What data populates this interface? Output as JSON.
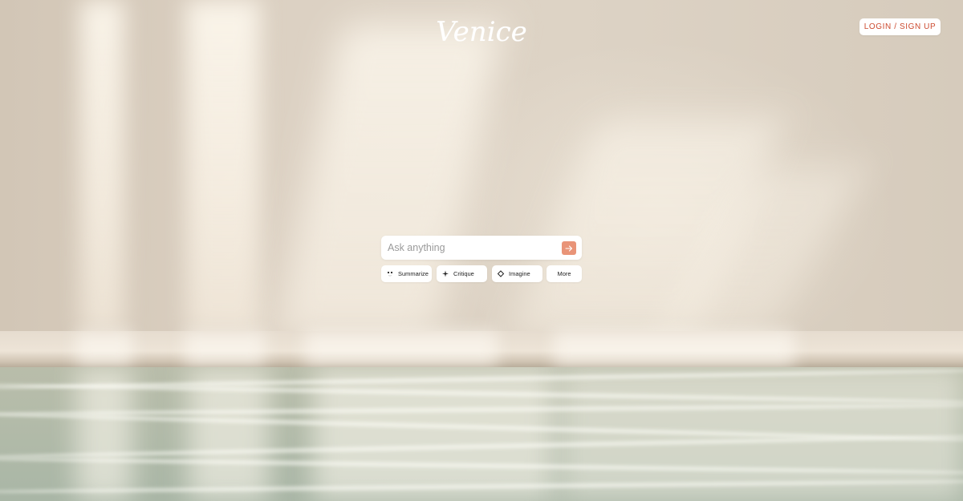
{
  "header": {
    "logo_text": "Venice",
    "login_label": "LOGIN / SIGN UP"
  },
  "search": {
    "placeholder": "Ask anything",
    "send_icon": "arrow-right-icon"
  },
  "chips": {
    "summarize": {
      "label": "Summarize",
      "icon": "face-icon"
    },
    "critique": {
      "label": "Critique",
      "icon": "sparkle-icon"
    },
    "imagine": {
      "label": "Imagine",
      "icon": "diamond-icon"
    },
    "more": {
      "label": "More"
    }
  },
  "colors": {
    "accent": "#e99478",
    "login_text": "#cc4a2f"
  }
}
